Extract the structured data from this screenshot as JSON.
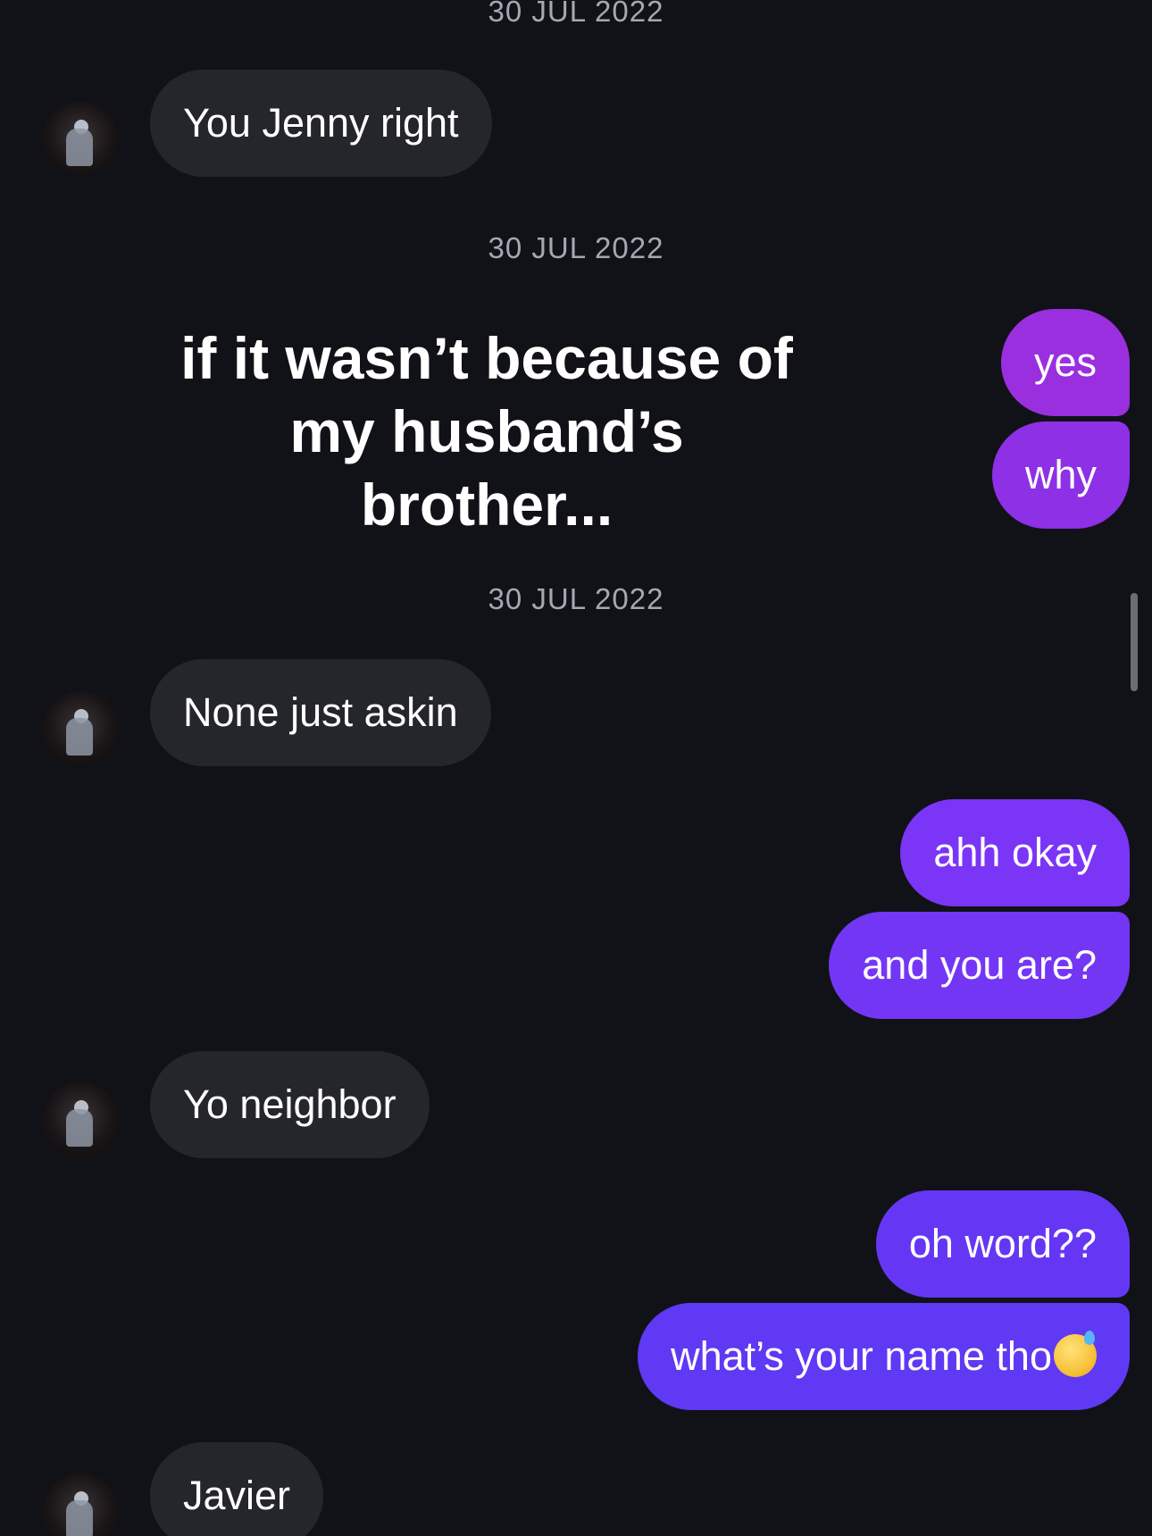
{
  "dates": {
    "d1": "30 JUL 2022",
    "d2": "30 JUL 2022",
    "d3": "30 JUL 2022"
  },
  "story_caption": "if it wasn’t because of my husband’s brother...",
  "messages": {
    "m1": "You Jenny right",
    "m2": "yes",
    "m3": "why",
    "m4": "None just askin",
    "m5": "ahh okay",
    "m6": "and you are?",
    "m7": "Yo neighbor",
    "m8": "oh word??",
    "m9": "what’s your name tho",
    "m10": "Javier"
  },
  "emoji": {
    "m9_icon": "grinning-face-with-sweat-icon"
  },
  "colors": {
    "background": "#111217",
    "incoming_bubble": "#25262c",
    "outgoing_purple_top": "#9a2fe0",
    "outgoing_purple": "#7b35f6",
    "outgoing_indigo": "#5f39f3",
    "date_text": "#a5a8b2"
  }
}
